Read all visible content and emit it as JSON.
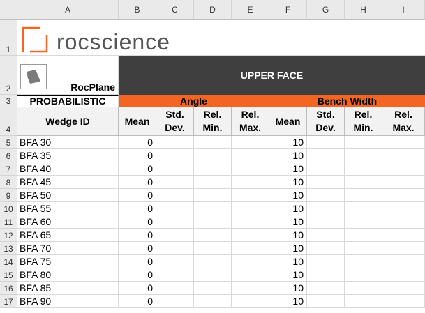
{
  "columns": [
    "A",
    "B",
    "C",
    "D",
    "E",
    "F",
    "G",
    "H",
    "I"
  ],
  "rows": [
    "1",
    "2",
    "3",
    "4",
    "5",
    "6",
    "7",
    "8",
    "9",
    "10",
    "11",
    "12",
    "13",
    "14",
    "15",
    "16",
    "17"
  ],
  "logo": {
    "text": "rocscience",
    "color": "#f26522"
  },
  "product": {
    "name": "RocPlane",
    "mode": "PROBABILISTIC"
  },
  "header": {
    "upper_face": "UPPER FACE",
    "angle": "Angle",
    "bench_width": "Bench Width",
    "wedge_id": "Wedge ID",
    "sub": [
      "Mean",
      "Std.\nDev.",
      "Rel.\nMin.",
      "Rel.\nMax.",
      "Mean",
      "Std.\nDev.",
      "Rel.\nMin.",
      "Rel.\nMax."
    ]
  },
  "data": [
    {
      "id": "BFA 30",
      "angle_mean": "0",
      "bench_mean": "10"
    },
    {
      "id": "BFA 35",
      "angle_mean": "0",
      "bench_mean": "10"
    },
    {
      "id": "BFA 40",
      "angle_mean": "0",
      "bench_mean": "10"
    },
    {
      "id": "BFA 45",
      "angle_mean": "0",
      "bench_mean": "10"
    },
    {
      "id": "BFA 50",
      "angle_mean": "0",
      "bench_mean": "10"
    },
    {
      "id": "BFA 55",
      "angle_mean": "0",
      "bench_mean": "10"
    },
    {
      "id": "BFA 60",
      "angle_mean": "0",
      "bench_mean": "10"
    },
    {
      "id": "BFA 65",
      "angle_mean": "0",
      "bench_mean": "10"
    },
    {
      "id": "BFA 70",
      "angle_mean": "0",
      "bench_mean": "10"
    },
    {
      "id": "BFA 75",
      "angle_mean": "0",
      "bench_mean": "10"
    },
    {
      "id": "BFA 80",
      "angle_mean": "0",
      "bench_mean": "10"
    },
    {
      "id": "BFA 85",
      "angle_mean": "0",
      "bench_mean": "10"
    },
    {
      "id": "BFA 90",
      "angle_mean": "0",
      "bench_mean": "10"
    }
  ],
  "colors": {
    "dark_header": "#3f3f3f",
    "orange": "#f26522"
  }
}
